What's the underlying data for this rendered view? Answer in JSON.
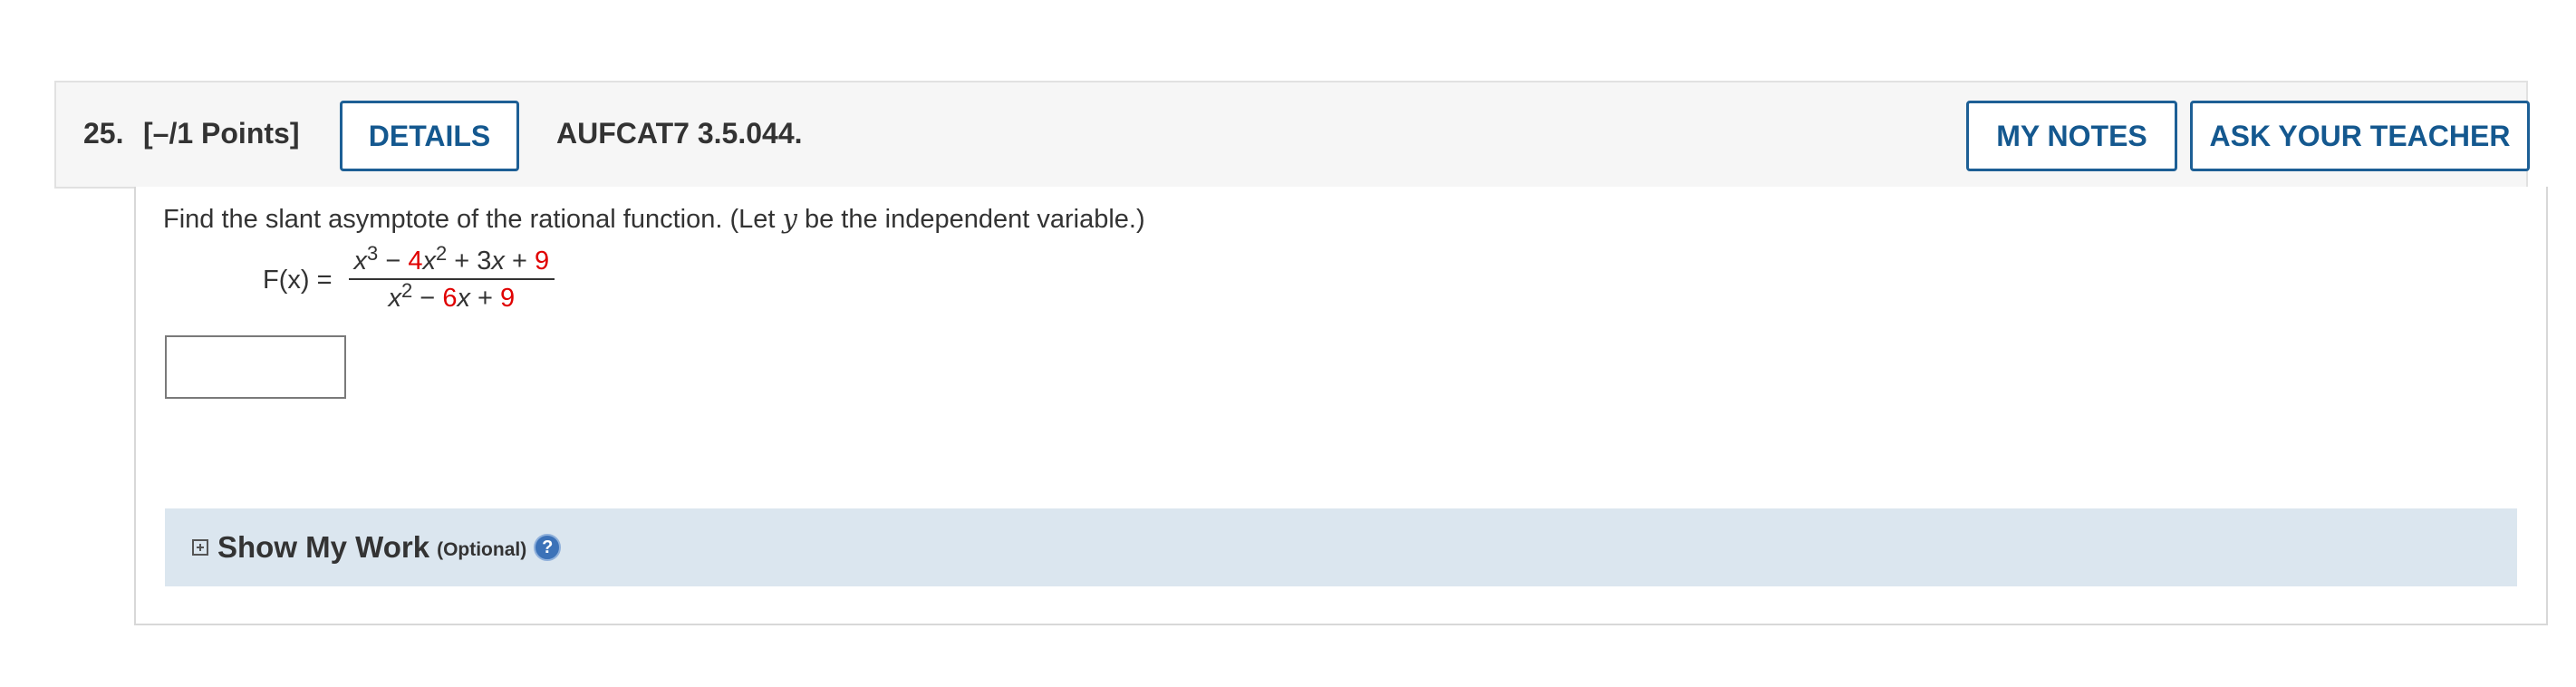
{
  "header": {
    "question_number": "25.",
    "points": "[–/1 Points]",
    "details_label": "DETAILS",
    "source": "AUFCAT7 3.5.044.",
    "my_notes_label": "MY NOTES",
    "ask_teacher_label": "ASK YOUR TEACHER"
  },
  "question": {
    "text_before": "Find the slant asymptote of the rational function. (Let ",
    "text_variable": "y",
    "text_after": " be the independent variable.)",
    "function_label": "F(x) =",
    "numerator": {
      "x": "x",
      "exp3": "3",
      "minus": " − ",
      "coef1": "4",
      "x2": "x",
      "exp2": "2",
      "plus1": " + 3",
      "x3": "x",
      "plus2": " + ",
      "const": "9"
    },
    "denominator": {
      "x": "x",
      "exp2": "2",
      "minus": " − ",
      "coef": "6",
      "x2": "x",
      "plus": " + ",
      "const": "9"
    },
    "answer_value": ""
  },
  "show_my_work": {
    "title": "Show My Work",
    "optional": "(Optional)",
    "help_glyph": "?",
    "expand_icon": "plus-square-icon",
    "help_icon": "question-circle-icon"
  },
  "colors": {
    "accent": "#1d5f95",
    "highlight_red": "#e00000",
    "work_panel_bg": "#dbe6ef",
    "header_bg": "#f6f6f6"
  }
}
